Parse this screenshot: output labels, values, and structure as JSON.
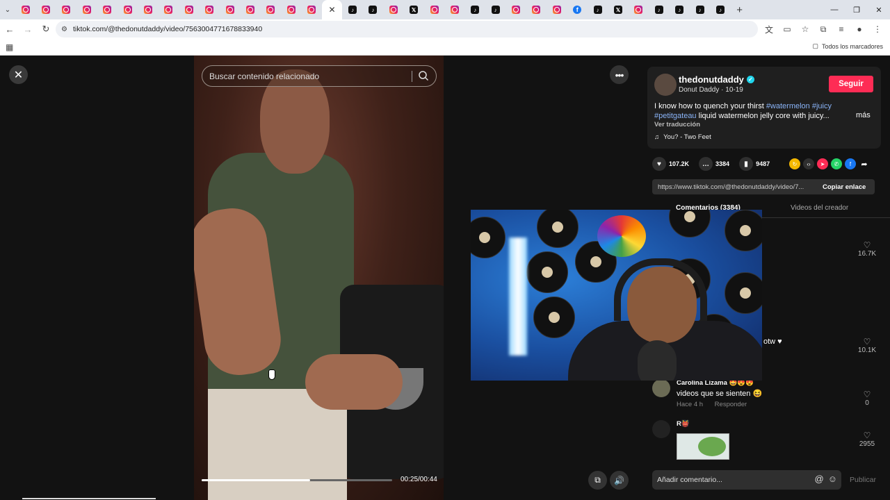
{
  "browser": {
    "tabs": [
      "instagram",
      "instagram",
      "instagram",
      "instagram",
      "instagram",
      "instagram",
      "instagram",
      "instagram",
      "instagram",
      "instagram",
      "instagram",
      "instagram",
      "instagram",
      "instagram",
      "instagram",
      "active",
      "tiktok",
      "tiktok",
      "instagram",
      "x",
      "instagram",
      "instagram",
      "tiktok",
      "tiktok",
      "instagram",
      "instagram",
      "instagram",
      "facebook",
      "tiktok",
      "x",
      "instagram",
      "tiktok",
      "tiktok",
      "tiktok",
      "tiktok"
    ],
    "url": "tiktok.com/@thedonutdaddy/video/7563004771678833940",
    "bookmarks_all": "Todos los marcadores"
  },
  "video": {
    "search_placeholder": "Buscar contenido relacionado",
    "progress_fraction": 0.57,
    "timecode": "00:25/00:44"
  },
  "post": {
    "username": "thedonutdaddy",
    "subtitle": "Donut Daddy · 10-19",
    "follow_label": "Seguir",
    "description_text_1": "I know how to quench your thirst ",
    "tag1": "#watermelon",
    "tag2": "#juicy",
    "tag3": "#petitgateau",
    "description_text_2": " liquid watermelon jelly core with juicy...",
    "more_label": "más",
    "translate_label": "Ver traducción",
    "music": "You? - Two Feet",
    "likes": "107.2K",
    "comments": "3384",
    "saves": "9487",
    "share_link": "https://www.tiktok.com/@thedonutdaddy/video/7...",
    "copy_link_label": "Copiar enlace",
    "tab_comments": "Comentarios (3384)",
    "tab_creator": "Videos del creador"
  },
  "comments": [
    {
      "likes": "16.7K"
    },
    {
      "partial_text": "otw ♥",
      "likes": "10.1K"
    },
    {
      "name": "Carolina Lizama 🤩😍😍",
      "text": "videos que se sienten 😆",
      "time": "Hace 4 h",
      "reply": "Responder",
      "likes": "0"
    },
    {
      "name": "R👹",
      "likes": "2955"
    }
  ],
  "composer": {
    "placeholder": "Añadir comentario...",
    "publish_label": "Publicar"
  },
  "colors": {
    "follow": "#fe2c55",
    "hashtag": "#8ab4f8",
    "verified": "#20d5ec"
  }
}
